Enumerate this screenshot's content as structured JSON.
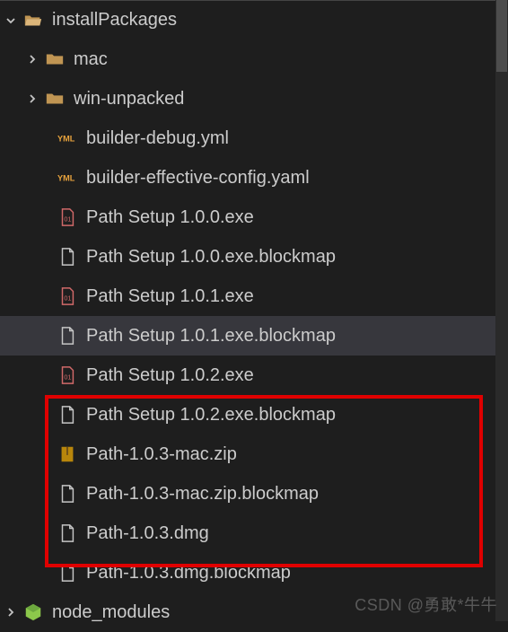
{
  "tree": {
    "root": {
      "label": "installPackages",
      "expanded": true
    },
    "children": [
      {
        "label": "mac",
        "type": "folder",
        "expanded": false
      },
      {
        "label": "win-unpacked",
        "type": "folder",
        "expanded": false
      },
      {
        "label": "builder-debug.yml",
        "type": "yaml"
      },
      {
        "label": "builder-effective-config.yaml",
        "type": "yaml"
      },
      {
        "label": "Path Setup 1.0.0.exe",
        "type": "binary"
      },
      {
        "label": "Path Setup 1.0.0.exe.blockmap",
        "type": "file"
      },
      {
        "label": "Path Setup 1.0.1.exe",
        "type": "binary"
      },
      {
        "label": "Path Setup 1.0.1.exe.blockmap",
        "type": "file",
        "selected": true
      },
      {
        "label": "Path Setup 1.0.2.exe",
        "type": "binary"
      },
      {
        "label": "Path Setup 1.0.2.exe.blockmap",
        "type": "file"
      },
      {
        "label": "Path-1.0.3-mac.zip",
        "type": "zip",
        "highlighted": true
      },
      {
        "label": "Path-1.0.3-mac.zip.blockmap",
        "type": "file",
        "highlighted": true
      },
      {
        "label": "Path-1.0.3.dmg",
        "type": "file",
        "highlighted": true
      },
      {
        "label": "Path-1.0.3.dmg.blockmap",
        "type": "file",
        "highlighted": true
      }
    ],
    "sibling": {
      "label": "node_modules",
      "type": "node",
      "expanded": false
    }
  },
  "watermark": "CSDN @勇敢*牛牛"
}
